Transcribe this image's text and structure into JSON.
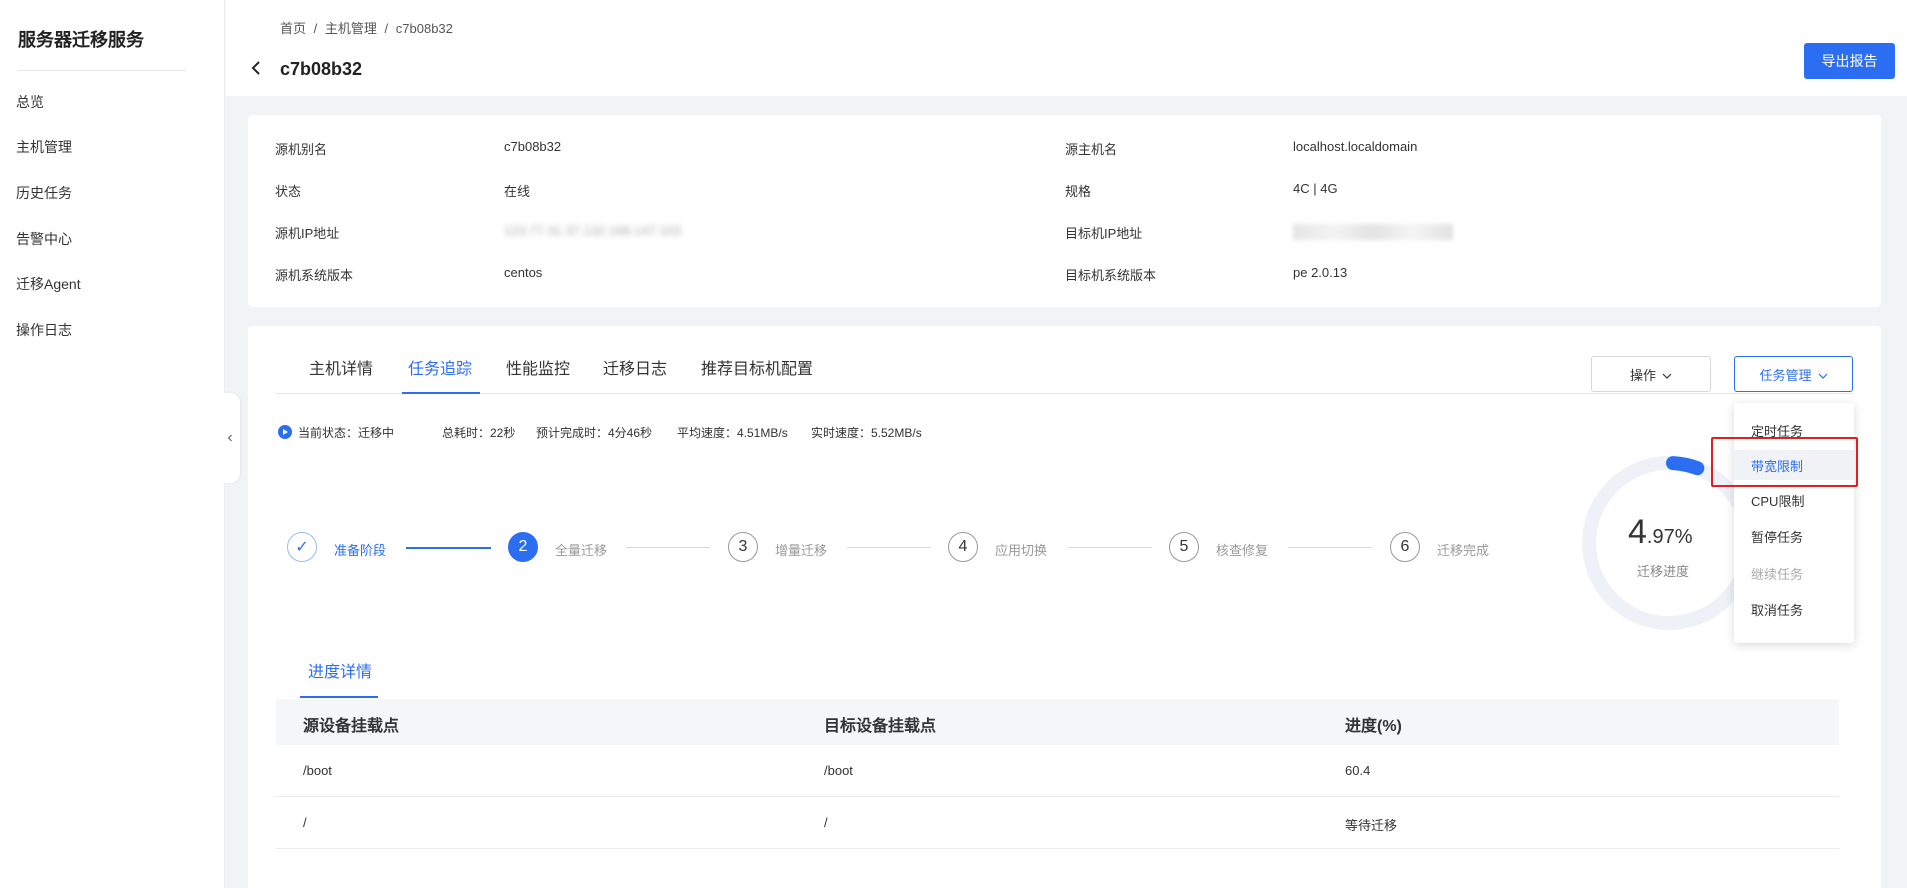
{
  "sidebar": {
    "title": "服务器迁移服务",
    "items": [
      "总览",
      "主机管理",
      "历史任务",
      "告警中心",
      "迁移Agent",
      "操作日志"
    ]
  },
  "header": {
    "breadcrumb": [
      "首页",
      "/",
      "主机管理",
      "/",
      "c7b08b32"
    ],
    "title": "c7b08b32",
    "export_label": "导出报告"
  },
  "info": {
    "source_alias_label": "源机别名",
    "source_alias": "c7b08b32",
    "status_label": "状态",
    "status": "在线",
    "source_ip_label": "源机IP地址",
    "source_ip": "123.77.31.37.132.168.147.103",
    "source_os_label": "源机系统版本",
    "source_os": "centos",
    "source_hostname_label": "源主机名",
    "source_hostname": "localhost.localdomain",
    "spec_label": "规格",
    "spec": "4C | 4G",
    "target_ip_label": "目标机IP地址",
    "target_os_label": "目标机系统版本",
    "target_os": "pe 2.0.13"
  },
  "tabs": [
    "主机详情",
    "任务追踪",
    "性能监控",
    "迁移日志",
    "推荐目标机配置"
  ],
  "controls": {
    "ops_label": "操作",
    "task_mgmt_label": "任务管理"
  },
  "status": {
    "current": "当前状态：迁移中",
    "elapsed": "总耗时：22秒",
    "eta": "预计完成时：4分46秒",
    "avg_speed": "平均速度：4.51MB/s",
    "real_speed": "实时速度：5.52MB/s"
  },
  "steps": [
    {
      "num": "✓",
      "label": "准备阶段",
      "state": "done"
    },
    {
      "num": "2",
      "label": "全量迁移",
      "state": "active"
    },
    {
      "num": "3",
      "label": "增量迁移",
      "state": "pending"
    },
    {
      "num": "4",
      "label": "应用切换",
      "state": "pending"
    },
    {
      "num": "5",
      "label": "核查修复",
      "state": "pending"
    },
    {
      "num": "6",
      "label": "迁移完成",
      "state": "pending"
    }
  ],
  "progress": {
    "int": "4",
    "dec": ".97%",
    "caption": "迁移进度",
    "fraction": 0.0497
  },
  "dropdown": {
    "items": [
      "定时任务",
      "带宽限制",
      "CPU限制",
      "暂停任务",
      "继续任务",
      "取消任务"
    ]
  },
  "details": {
    "tab": "进度详情",
    "columns": [
      "源设备挂载点",
      "目标设备挂载点",
      "进度(%)"
    ],
    "rows": [
      [
        "/boot",
        "/boot",
        "60.4"
      ],
      [
        "/",
        "/",
        "等待迁移"
      ]
    ]
  },
  "colors": {
    "accent": "#2c6ef2",
    "highlight": "#e02020"
  }
}
